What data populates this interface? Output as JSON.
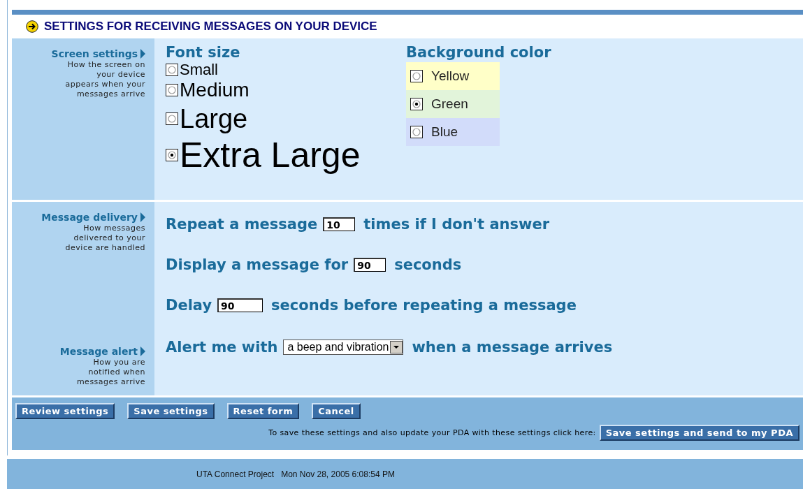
{
  "title": "SETTINGS FOR RECEIVING MESSAGES ON YOUR DEVICE",
  "screen": {
    "label": "Screen settings",
    "description": "How the screen on your device appears when your messages arrive",
    "font_size": {
      "heading": "Font size",
      "options": [
        {
          "label": "Small",
          "selected": false
        },
        {
          "label": "Medium",
          "selected": false
        },
        {
          "label": "Large",
          "selected": false
        },
        {
          "label": "Extra Large",
          "selected": true
        }
      ]
    },
    "background_color": {
      "heading": "Background color",
      "options": [
        {
          "label": "Yellow",
          "selected": false,
          "color": "#ffffc8"
        },
        {
          "label": "Green",
          "selected": true,
          "color": "#e2f4da"
        },
        {
          "label": "Blue",
          "selected": false,
          "color": "#d2dcfa"
        }
      ]
    }
  },
  "delivery": {
    "label": "Message delivery",
    "description": "How messages delivered to your device are handled",
    "rows": [
      {
        "kind": "input",
        "before": "Repeat a message",
        "value": "10",
        "after": "times if I don't answer"
      },
      {
        "kind": "input",
        "before": "Display a message for",
        "value": "90",
        "after": "seconds"
      },
      {
        "kind": "input",
        "before": "Delay",
        "value": "90",
        "after": "seconds before repeating a message"
      }
    ]
  },
  "alert": {
    "label": "Message alert",
    "description": "How you are notified when messages arrive",
    "row": {
      "kind": "select",
      "before": "Alert me with",
      "value": "a beep and vibration",
      "after": "when a message arrives"
    }
  },
  "buttons": [
    "Review settings",
    "Save settings",
    "Reset form",
    "Cancel"
  ],
  "pda_note": "To save these settings and also update your PDA with these settings click here:",
  "pda_button": "Save settings and send to my PDA",
  "footer": {
    "project": "UTA Connect Project",
    "timestamp": "Mon Nov 28, 2005 6:08:54 PM"
  }
}
